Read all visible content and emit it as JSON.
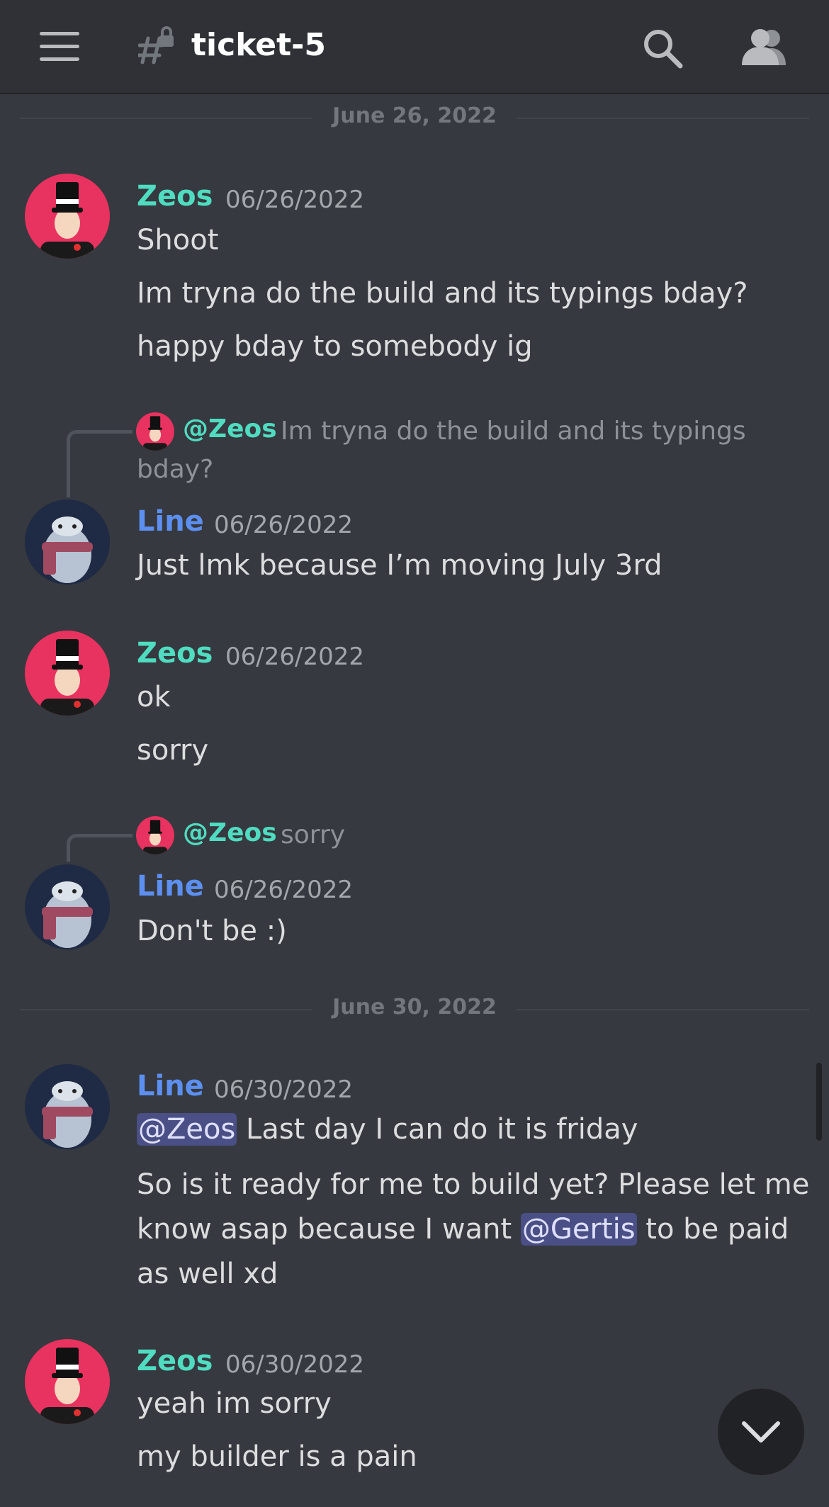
{
  "header": {
    "channel_name": "ticket-5",
    "icons": [
      "menu-icon",
      "locked-channel-icon",
      "search-icon",
      "members-icon"
    ]
  },
  "dividers": [
    "June 26, 2022",
    "June 30, 2022"
  ],
  "messages": [
    {
      "author": "Zeos",
      "timestamp": "06/26/2022",
      "lines": [
        "Shoot",
        "Im tryna do the build and its typings bday?",
        "happy bday to somebody ig"
      ]
    },
    {
      "reply": {
        "mention": "@Zeos",
        "text": "Im tryna do the build and its typings",
        "text_cont": "bday?"
      },
      "author": "Line",
      "timestamp": "06/26/2022",
      "lines": [
        "Just lmk because I’m moving July 3rd"
      ]
    },
    {
      "author": "Zeos",
      "timestamp": "06/26/2022",
      "lines": [
        "ok",
        "sorry"
      ]
    },
    {
      "reply": {
        "mention": "@Zeos",
        "text": "sorry"
      },
      "author": "Line",
      "timestamp": "06/26/2022",
      "lines": [
        "Don't be :)"
      ]
    },
    {
      "author": "Line",
      "timestamp": "06/30/2022",
      "line1": {
        "mention": "@Zeos",
        "text": " Last day I can do it is friday"
      },
      "line2": {
        "pre": "So is it ready for me to build yet? Please let me know asap because I want ",
        "mention": "@Gertis",
        "post": " to be paid as well xd"
      }
    },
    {
      "author": "Zeos",
      "timestamp": "06/30/2022",
      "lines": [
        "yeah im sorry",
        "my builder is a pain"
      ]
    }
  ],
  "colors": {
    "background": "#36393f",
    "header": "#2f3136",
    "zeos_name": "#4fdcc0",
    "line_name": "#5c8ff0",
    "mention_bg": "#4a4f86"
  }
}
